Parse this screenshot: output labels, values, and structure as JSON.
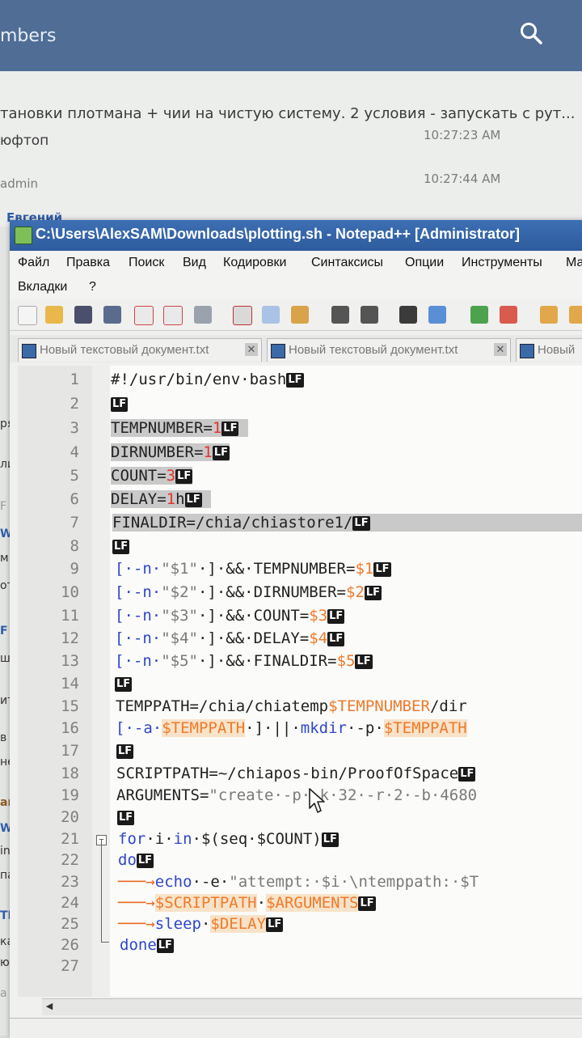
{
  "background": {
    "header_title": "mbers",
    "message_preview": "тановки плотмана + чии на чистую систему. 2 условия - запускать с рут...",
    "row1_name": "юфтоп",
    "row1_time": "10:27:23 AM",
    "row2_name": "admin",
    "row2_time": "10:27:44 AM",
    "row3_name": "Евгений",
    "left_fragments": [
      "ря",
      "ли",
      "F a",
      "WTF",
      "м г",
      "от",
      "F",
      "ши",
      "ит,",
      "в т",
      "не з",
      "am",
      "WTF",
      "in $(",
      "па б",
      "TF",
      "каж",
      "ющу",
      "a me"
    ]
  },
  "window": {
    "title": "C:\\Users\\AlexSAM\\Downloads\\plotting.sh - Notepad++ [Administrator]",
    "menu": [
      "Файл",
      "Правка",
      "Поиск",
      "Вид",
      "Кодировки",
      "Синтаксисы",
      "Опции",
      "Инструменты",
      "Ма",
      "Вкладки",
      "?"
    ],
    "tabs": [
      {
        "label": "Новый текстовый документ.txt"
      },
      {
        "label": "Новый текстовый документ.txt"
      },
      {
        "label": "Новый"
      }
    ],
    "eol_marker": "LF",
    "line_numbers": [
      "1",
      "2",
      "3",
      "4",
      "5",
      "6",
      "7",
      "8",
      "9",
      "10",
      "11",
      "12",
      "13",
      "14",
      "15",
      "16",
      "17",
      "18",
      "19",
      "20",
      "21",
      "22",
      "23",
      "24",
      "25",
      "26",
      "27"
    ],
    "code": {
      "l1": "#!/usr/bin/env·bash",
      "l3a": "TEMPNUMBER=",
      "l3b": "1",
      "l4a": "DIRNUMBER=",
      "l4b": "1",
      "l5a": "COUNT=",
      "l5b": "3",
      "l6a": "DELAY=",
      "l6b": "1",
      "l6c": "h",
      "l7": "FINALDIR=/chia/chiastore1/",
      "l9a": "[·-n·",
      "l9b": "\"$1\"",
      "l9c": "·]·&&·TEMPNUMBER=",
      "l9d": "$1",
      "l10a": "[·-n·",
      "l10b": "\"$2\"",
      "l10c": "·]·&&·DIRNUMBER=",
      "l10d": "$2",
      "l11a": "[·-n·",
      "l11b": "\"$3\"",
      "l11c": "·]·&&·COUNT=",
      "l11d": "$3",
      "l12a": "[·-n·",
      "l12b": "\"$4\"",
      "l12c": "·]·&&·DELAY=",
      "l12d": "$4",
      "l13a": "[·-n·",
      "l13b": "\"$5\"",
      "l13c": "·]·&&·FINALDIR=",
      "l13d": "$5",
      "l15a": "TEMPPATH=/chia/chiatemp",
      "l15b": "$TEMPNUMBER",
      "l15c": "/dir",
      "l16a": "[·-a·",
      "l16b": "$TEMPPATH",
      "l16c": "·]·||·",
      "l16d": "mkdir",
      "l16e": "·-p·",
      "l16f": "$TEMPPATH",
      "l18": "SCRIPTPATH=~/chiapos-bin/ProofOfSpace",
      "l19a": "ARGUMENTS=",
      "l19b": "\"create·-p·-k·32·-r·2·-b·4680",
      "l21a": "for",
      "l21b": "·i·",
      "l21c": "in",
      "l21d": "·$(seq·$COUNT)",
      "l22": "do",
      "l23a": "echo",
      "l23b": "·-e·",
      "l23c": "\"attempt:·$i·\\ntemppath:·$T",
      "l24a": "$SCRIPTPATH",
      "l24b": "·",
      "l24c": "$ARGUMENTS",
      "l25a": "sleep",
      "l25b": "·",
      "l25c": "$DELAY",
      "l26": "done"
    }
  },
  "colors": {
    "titlebar": "#2e5c9e",
    "number": "#e2352e",
    "variable": "#f07a2a",
    "keyword": "#2f46c8",
    "selection": "#c9c9c9"
  }
}
